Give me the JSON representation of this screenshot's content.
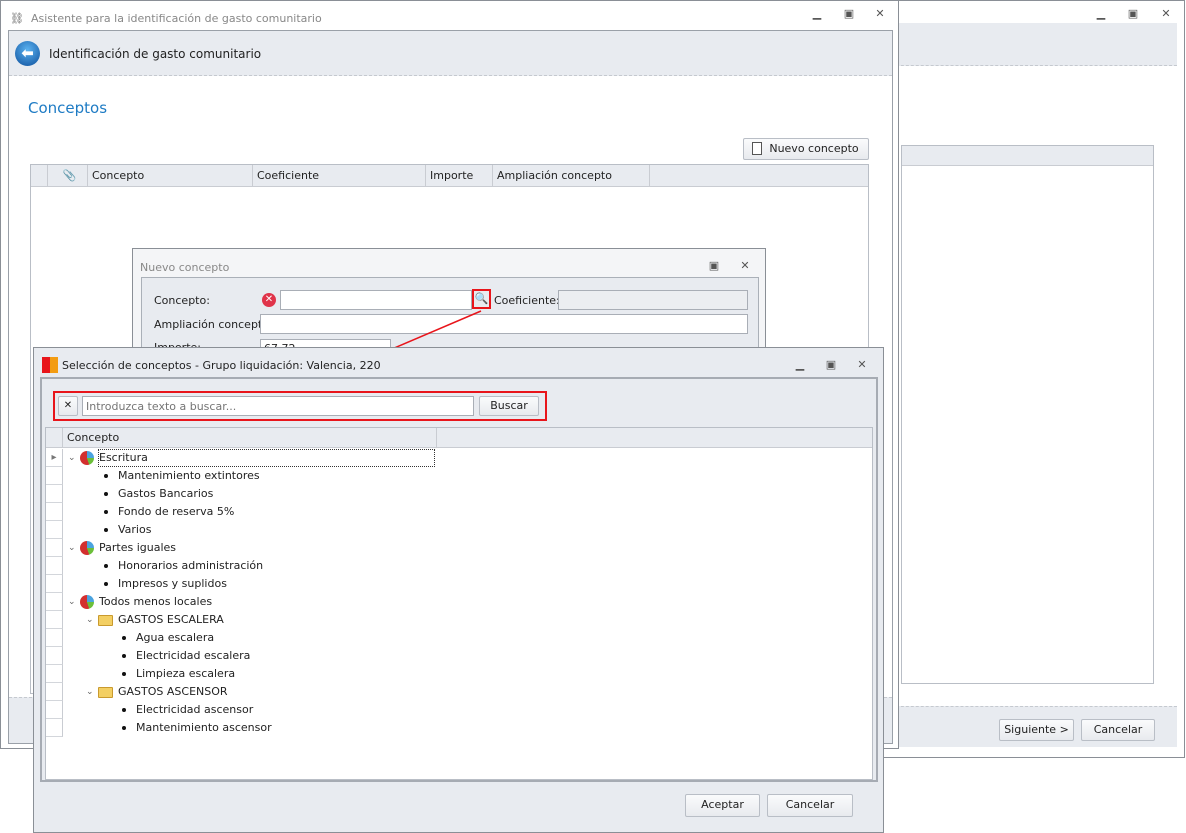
{
  "back_window": {
    "next_label": "Siguiente >",
    "cancel_label": "Cancelar"
  },
  "main_window": {
    "title": "Asistente para la identificación de gasto comunitario",
    "header": "Identificación de gasto comunitario",
    "section": "Conceptos",
    "new_concept_label": "Nuevo concepto",
    "columns": [
      "Concepto",
      "Coeficiente",
      "Importe",
      "Ampliación concepto"
    ]
  },
  "new_concept_dialog": {
    "title": "Nuevo concepto",
    "concepto_label": "Concepto:",
    "coeficiente_label": "Coeficiente:",
    "ampliacion_label": "Ampliación concepto:",
    "importe_label": "Importe:",
    "importe_value": "67,72"
  },
  "selection_dialog": {
    "title": "Selección de conceptos - Grupo liquidación: Valencia, 220",
    "search_placeholder": "Introduzca texto a buscar...",
    "search_button": "Buscar",
    "column": "Concepto",
    "tree": [
      {
        "label": "Escritura",
        "type": "group",
        "children": [
          "Mantenimiento extintores",
          "Gastos Bancarios",
          "Fondo de reserva 5%",
          "Varios"
        ]
      },
      {
        "label": "Partes iguales",
        "type": "group",
        "children": [
          "Honorarios administración",
          "Impresos y suplidos"
        ]
      },
      {
        "label": "Todos menos locales",
        "type": "group",
        "folders": [
          {
            "label": "GASTOS ESCALERA",
            "children": [
              "Agua escalera",
              "Electricidad escalera",
              "Limpieza escalera"
            ]
          },
          {
            "label": "GASTOS ASCENSOR",
            "children": [
              "Electricidad ascensor",
              "Mantenimiento ascensor"
            ]
          }
        ]
      }
    ],
    "accept_label": "Aceptar",
    "cancel_label": "Cancelar"
  },
  "colors": {
    "accent": "#1e7bc4",
    "highlight": "#e8151b"
  }
}
